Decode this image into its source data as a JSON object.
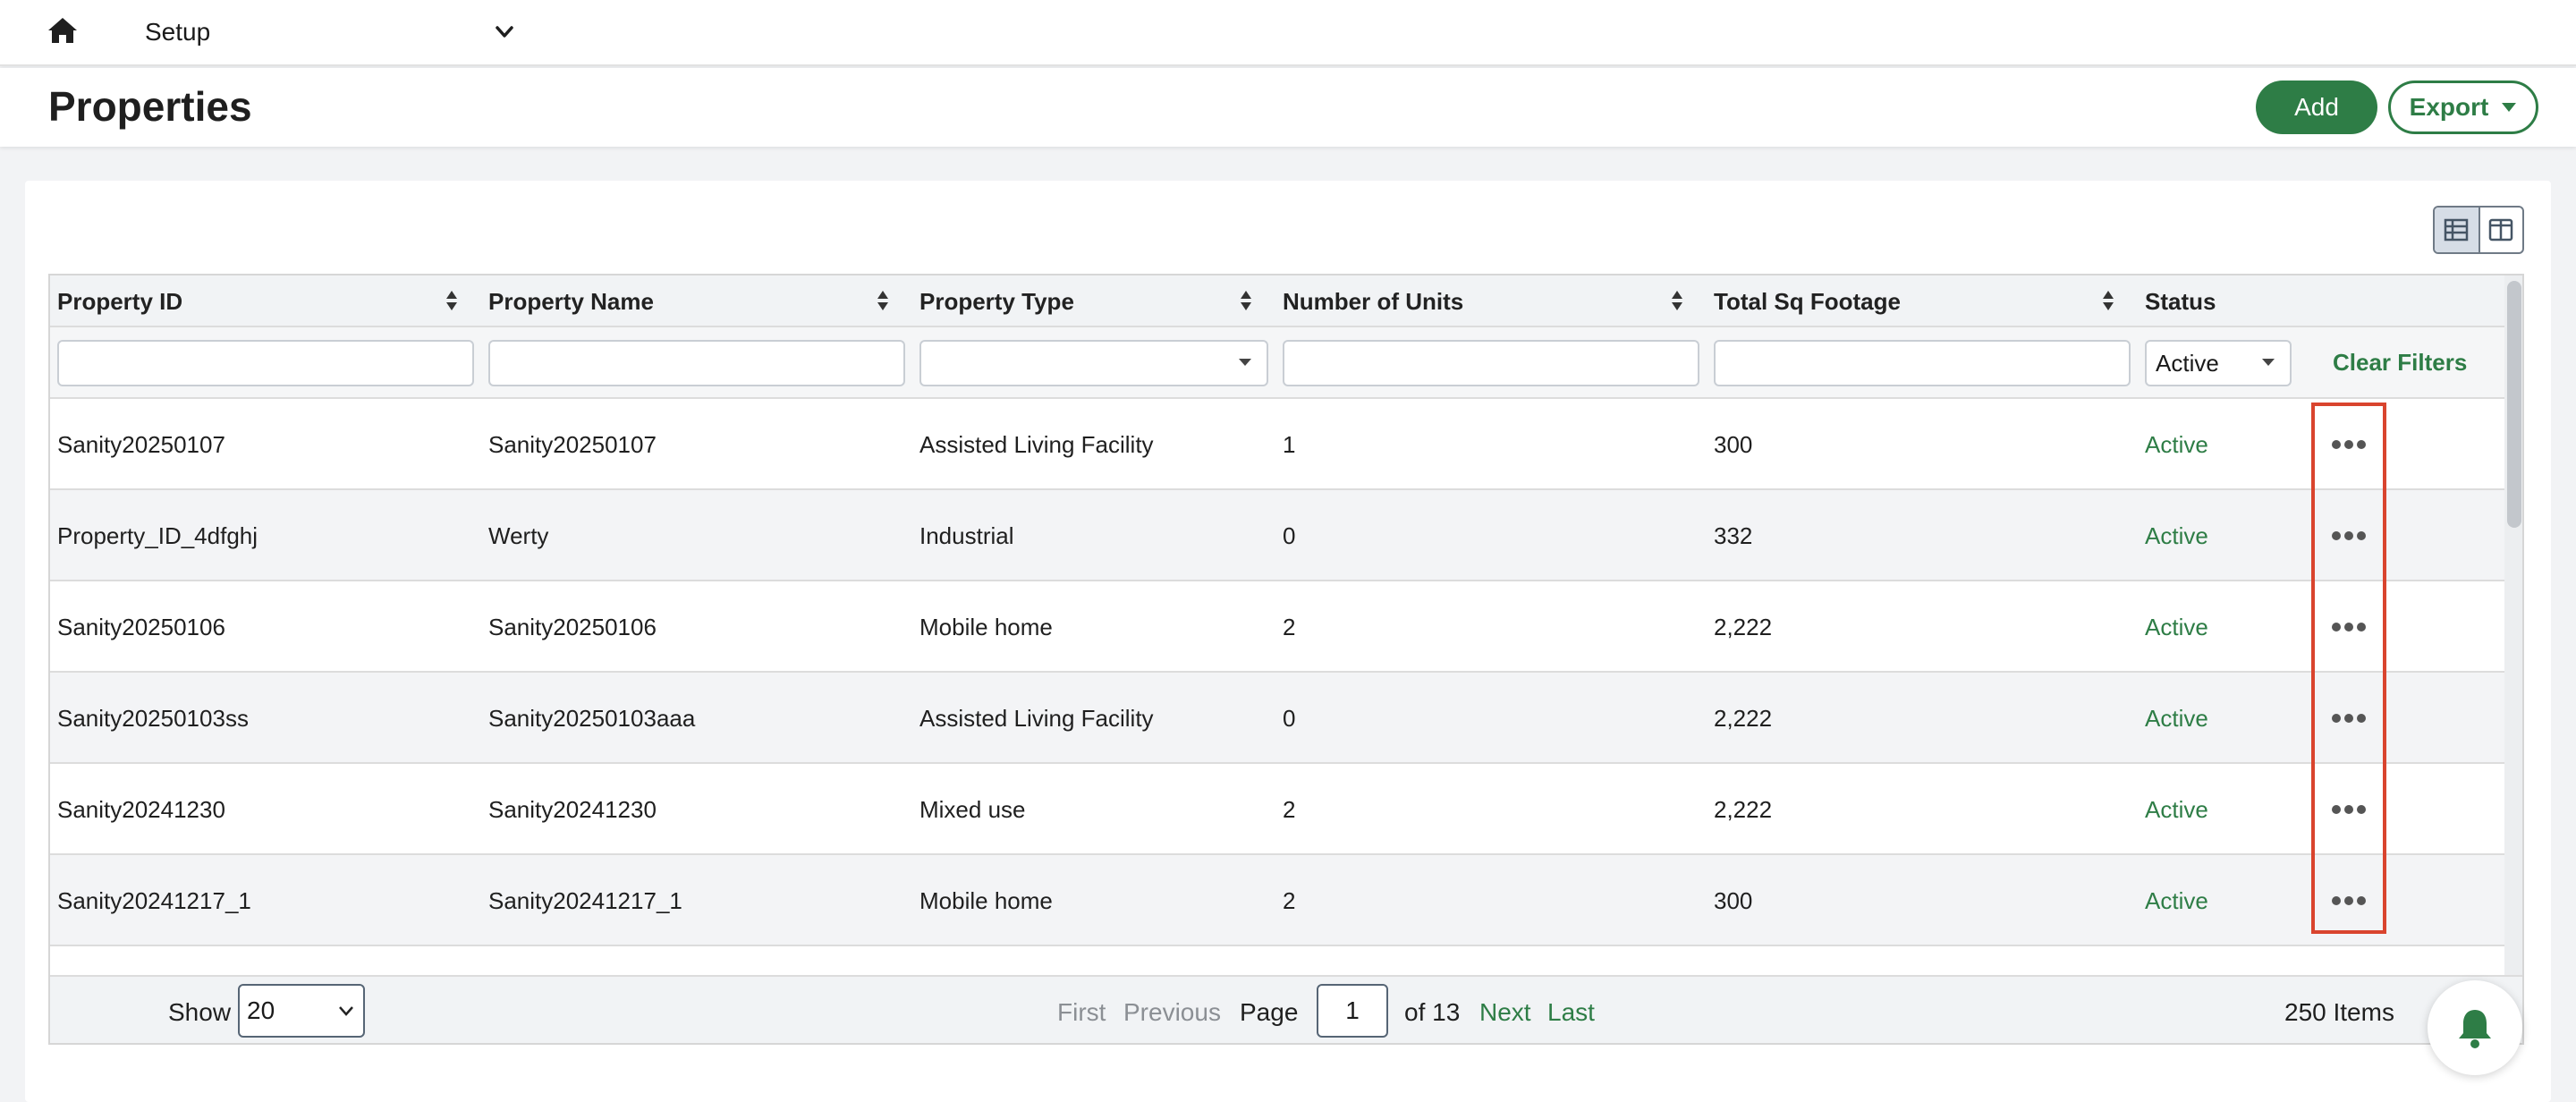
{
  "topbar": {
    "home_icon": "home-icon",
    "setup_label": "Setup",
    "setup_chevron_icon": "chevron-down-icon"
  },
  "header": {
    "title": "Properties",
    "add_label": "Add",
    "export_label": "Export",
    "brand_color": "#2e7d46"
  },
  "view_toggle": {
    "options": [
      "table-view-icon",
      "split-view-icon"
    ],
    "active": "table-view-icon"
  },
  "table": {
    "columns": [
      {
        "label": "Property ID",
        "sortable": true
      },
      {
        "label": "Property Name",
        "sortable": true
      },
      {
        "label": "Property Type",
        "sortable": true
      },
      {
        "label": "Number of Units",
        "sortable": true
      },
      {
        "label": "Total Sq Footage",
        "sortable": true
      },
      {
        "label": "Status",
        "sortable": false
      }
    ],
    "filters": {
      "property_id": "",
      "property_name": "",
      "property_type": "",
      "number_of_units": "",
      "total_sq_footage": "",
      "status": "Active",
      "clear_label": "Clear Filters"
    },
    "rows": [
      {
        "id": "Sanity20250107",
        "name": "Sanity20250107",
        "type": "Assisted Living Facility",
        "units": "1",
        "sqft": "300",
        "status": "Active"
      },
      {
        "id": "Property_ID_4dfghj",
        "name": "Werty",
        "type": "Industrial",
        "units": "0",
        "sqft": "332",
        "status": "Active"
      },
      {
        "id": "Sanity20250106",
        "name": "Sanity20250106",
        "type": "Mobile home",
        "units": "2",
        "sqft": "2,222",
        "status": "Active"
      },
      {
        "id": "Sanity20250103ss",
        "name": "Sanity20250103aaa",
        "type": "Assisted Living Facility",
        "units": "0",
        "sqft": "2,222",
        "status": "Active"
      },
      {
        "id": "Sanity20241230",
        "name": "Sanity20241230",
        "type": "Mixed use",
        "units": "2",
        "sqft": "2,222",
        "status": "Active"
      },
      {
        "id": "Sanity20241217_1",
        "name": "Sanity20241217_1",
        "type": "Mobile home",
        "units": "2",
        "sqft": "300",
        "status": "Active"
      }
    ],
    "row_action_icon": "more-horizontal-icon"
  },
  "pager": {
    "show_label": "Show",
    "page_size": "20",
    "first_label": "First",
    "previous_label": "Previous",
    "page_label": "Page",
    "current_page": "1",
    "of_label": "of 13",
    "next_label": "Next",
    "last_label": "Last",
    "items_label": "250 Items"
  },
  "notifications": {
    "icon": "bell-icon"
  },
  "colors": {
    "highlight": "#d9442e",
    "status_active": "#2e7d46"
  }
}
